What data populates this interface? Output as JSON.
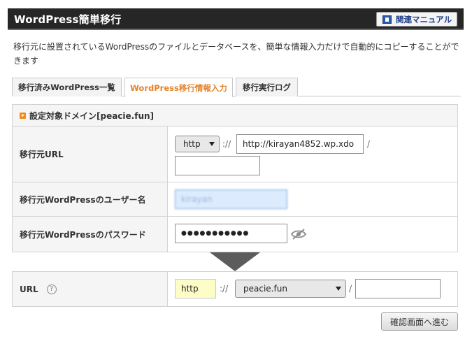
{
  "header": {
    "title": "WordPress簡単移行",
    "manual_label": "関連マニュアル"
  },
  "description": "移行元に設置されているWordPressのファイルとデータベースを、簡単な情報入力だけで自動的にコピーすることができます",
  "tabs": [
    {
      "label": "移行済みWordPress一覧",
      "active": false
    },
    {
      "label": "WordPress移行情報入力",
      "active": true
    },
    {
      "label": "移行実行ログ",
      "active": false
    }
  ],
  "settings": {
    "heading": "設定対象ドメイン[peacie.fun]",
    "source_url": {
      "label": "移行元URL",
      "protocol": "http",
      "separator": "://",
      "host_value": "http://kirayan4852.wp.xdo",
      "slash": "/",
      "path_value": ""
    },
    "username": {
      "label": "移行元WordPressのユーザー名",
      "value": "kirayan"
    },
    "password": {
      "label": "移行元WordPressのパスワード",
      "value": "●●●●●●●●●●●"
    }
  },
  "destination": {
    "label": "URL",
    "help": "?",
    "protocol": "http",
    "separator": "://",
    "domain": "peacie.fun",
    "slash": "/",
    "path_value": ""
  },
  "confirm_label": "確認画面へ進む",
  "colors": {
    "header_bg": "#262626",
    "active_tab": "#e5842a",
    "username_bg": "#dcebfd",
    "protocol_highlight": "#fdfdc8"
  }
}
